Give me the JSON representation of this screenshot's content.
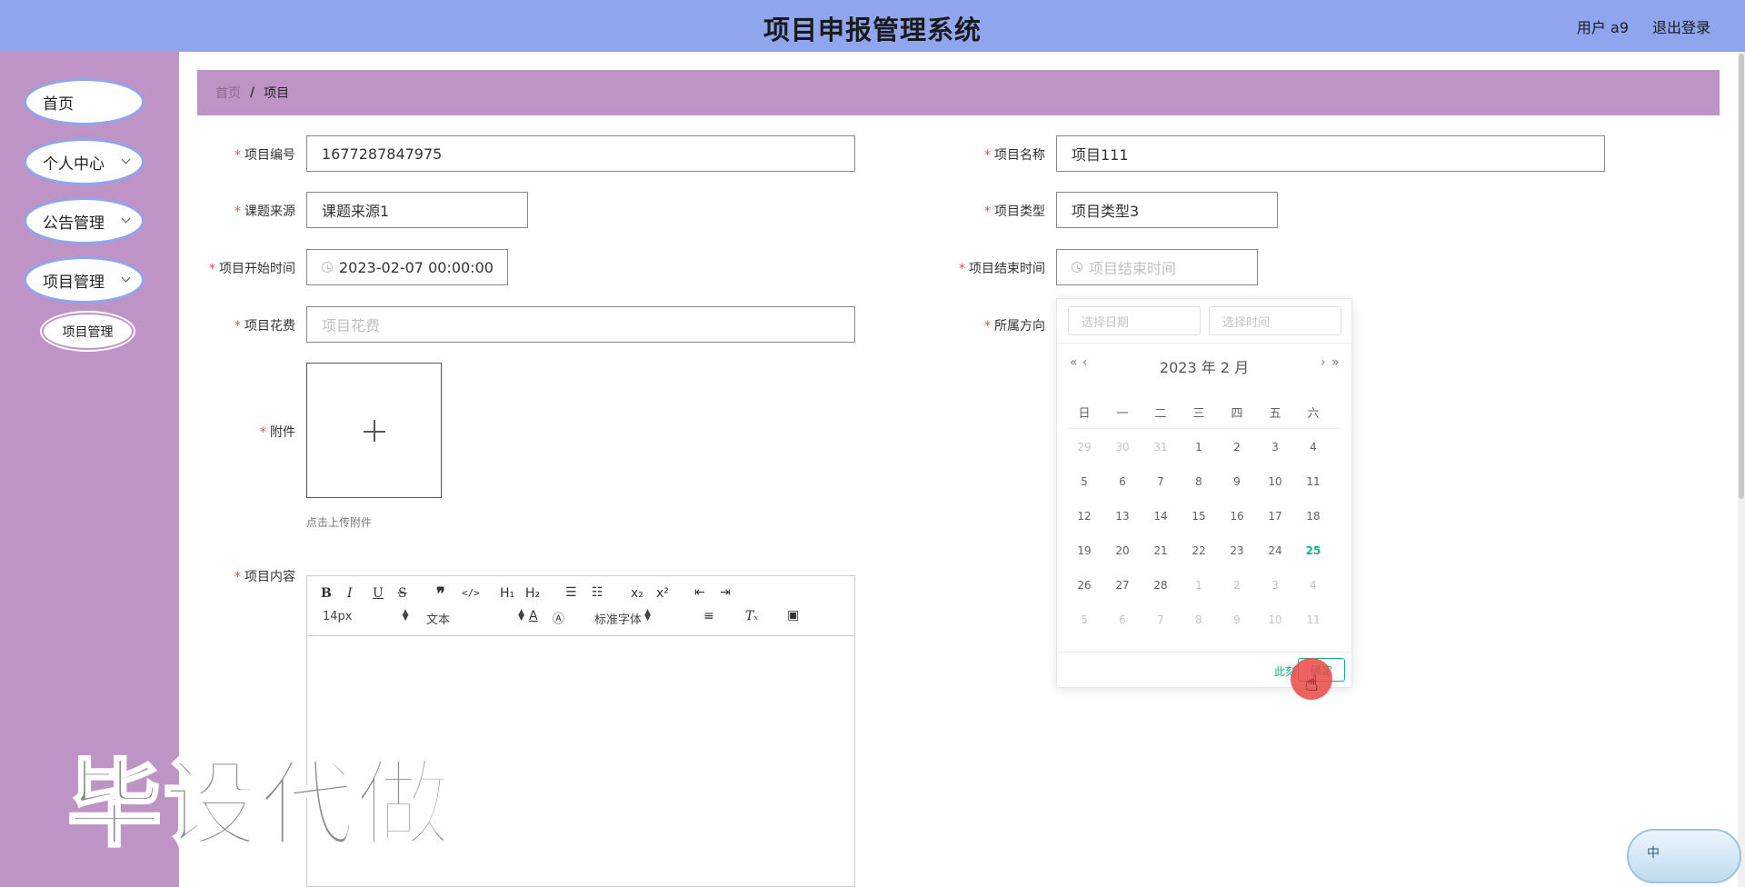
{
  "header": {
    "title": "项目申报管理系统",
    "user": "用户 a9",
    "logout": "退出登录"
  },
  "sidebar": {
    "items": [
      {
        "label": "首页"
      },
      {
        "label": "个人中心"
      },
      {
        "label": "公告管理"
      },
      {
        "label": "项目管理"
      }
    ],
    "sub_item": "项目管理"
  },
  "breadcrumb": {
    "home": "首页",
    "separator": "/",
    "current": "项目"
  },
  "form": {
    "project_no": {
      "label": "项目编号",
      "value": "1677287847975"
    },
    "project_name": {
      "label": "项目名称",
      "value": "项目111"
    },
    "topic_source": {
      "label": "课题来源",
      "value": "课题来源1"
    },
    "project_type": {
      "label": "项目类型",
      "value": "项目类型3"
    },
    "start_time": {
      "label": "项目开始时间",
      "value": "2023-02-07 00:00:00"
    },
    "end_time": {
      "label": "项目结束时间",
      "placeholder": "项目结束时间"
    },
    "cost": {
      "label": "项目花费",
      "placeholder": "项目花费"
    },
    "direction": {
      "label": "所属方向"
    },
    "attachment": {
      "label": "附件",
      "hint": "点击上传附件"
    },
    "content": {
      "label": "项目内容"
    }
  },
  "editor": {
    "font_size": "14px",
    "block_type": "文本",
    "font_family": "标准字体"
  },
  "datepicker": {
    "date_placeholder": "选择日期",
    "time_placeholder": "选择时间",
    "month_title": "2023 年  2 月",
    "weekdays": [
      "日",
      "一",
      "二",
      "三",
      "四",
      "五",
      "六"
    ],
    "weeks": [
      [
        "29",
        "30",
        "31",
        "1",
        "2",
        "3",
        "4"
      ],
      [
        "5",
        "6",
        "7",
        "8",
        "9",
        "10",
        "11"
      ],
      [
        "12",
        "13",
        "14",
        "15",
        "16",
        "17",
        "18"
      ],
      [
        "19",
        "20",
        "21",
        "22",
        "23",
        "24",
        "25"
      ],
      [
        "26",
        "27",
        "28",
        "1",
        "2",
        "3",
        "4"
      ],
      [
        "5",
        "6",
        "7",
        "8",
        "9",
        "10",
        "11"
      ]
    ],
    "today": "25",
    "now_label": "此刻",
    "ok_label": "确定",
    "accent_color": "#13b385"
  },
  "watermark": "毕设代做",
  "ime": {
    "label": "中"
  },
  "colors": {
    "header_bg": "#8fa5ee",
    "sidebar_bg": "#bd94c5",
    "required_star": "#e0504c"
  }
}
